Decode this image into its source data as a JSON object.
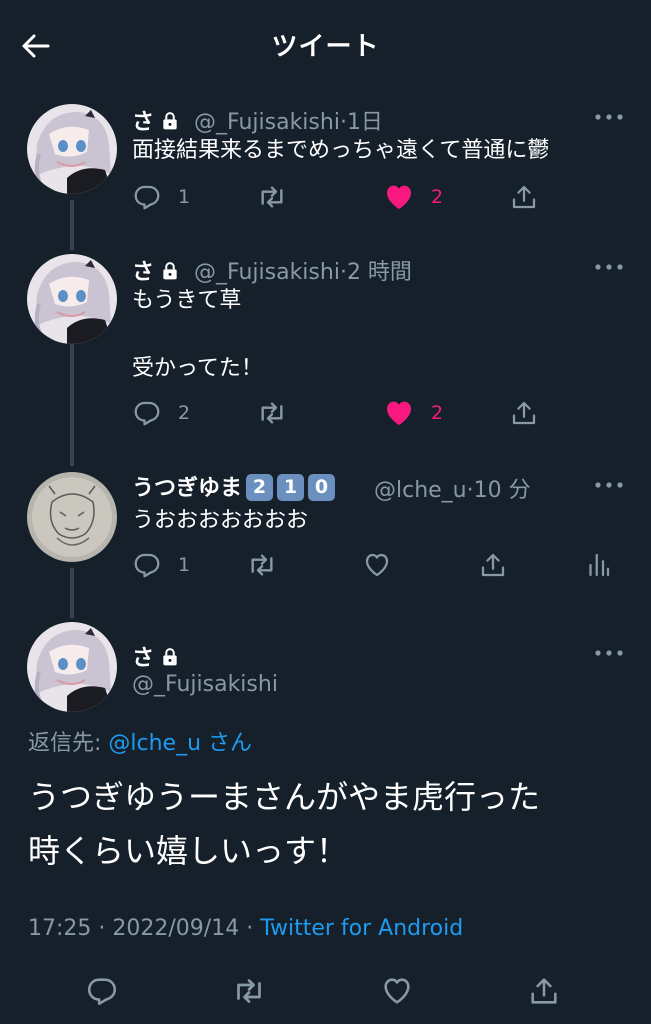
{
  "header": {
    "title": "ツイート"
  },
  "tweets": [
    {
      "name": "さ",
      "handle": "@_Fujisakishi",
      "time": "1日",
      "lines": [
        "面接結果来るまでめっちゃ遠くて普通に鬱"
      ],
      "reply_count": "1",
      "retweet_count": "",
      "like_count": "2",
      "liked": true
    },
    {
      "name": "さ",
      "handle": "@_Fujisakishi",
      "time": "2 時間",
      "lines": [
        "もうきて草",
        "",
        "受かってた！"
      ],
      "reply_count": "2",
      "retweet_count": "",
      "like_count": "2",
      "liked": true
    },
    {
      "name": "うつぎゆま",
      "name_emoji": [
        "2",
        "1",
        "0"
      ],
      "handle": "@lche_u",
      "time": "10 分",
      "lines": [
        "うおおおおおおお"
      ],
      "reply_count": "1",
      "retweet_count": "",
      "like_count": "",
      "liked": false
    }
  ],
  "main": {
    "name": "さ",
    "handle": "@_Fujisakishi",
    "reply_prefix": "返信先: ",
    "reply_handle": "@lche_u",
    "reply_suffix": "さん",
    "text_lines": [
      "うつぎゆうーまさんがやま虎行った",
      "時くらい嬉しいっす！"
    ],
    "time": "17:25",
    "date": "2022/09/14",
    "source": "Twitter for Android"
  },
  "colors": {
    "background": "#15202b",
    "secondary_text": "#8899a6",
    "link": "#1d9bf0",
    "like": "#f91880",
    "thread_line": "#38444d"
  },
  "icons": [
    "back-arrow-icon",
    "lock-icon",
    "more-icon",
    "reply-icon",
    "retweet-icon",
    "like-icon",
    "share-icon",
    "analytics-icon"
  ]
}
